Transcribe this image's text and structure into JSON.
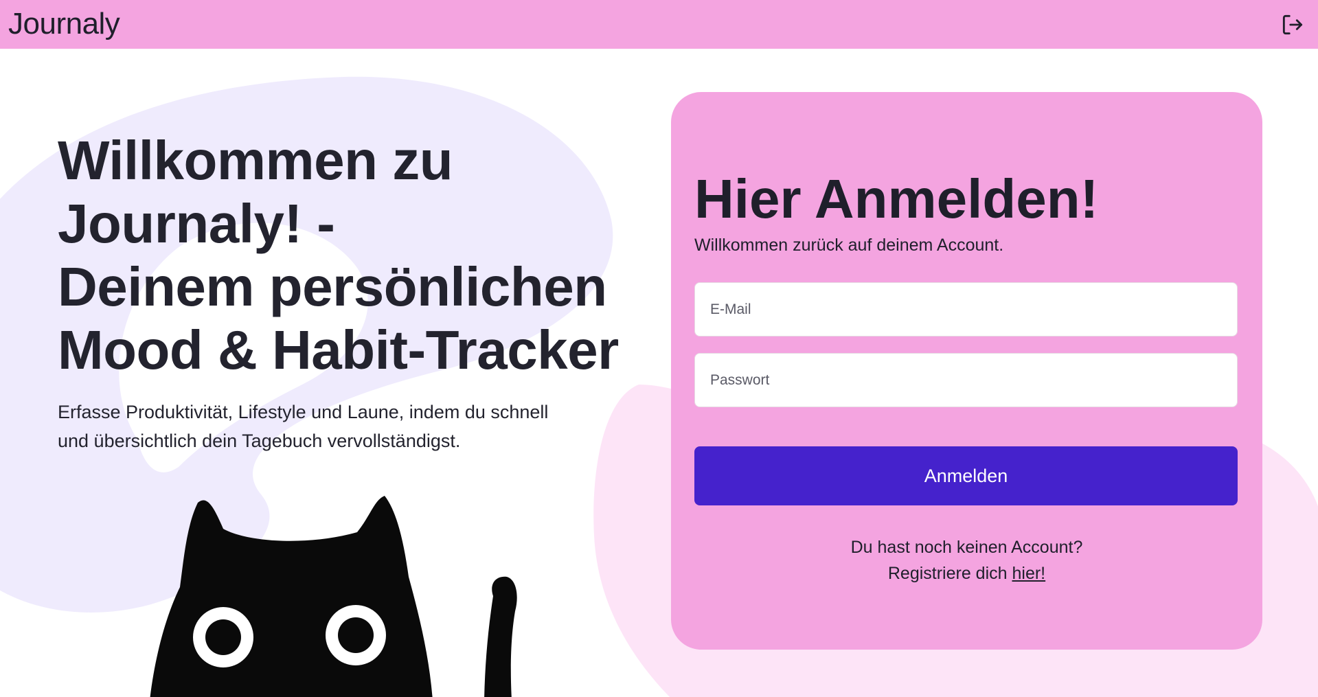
{
  "navbar": {
    "brand": "Journaly",
    "logout_icon": "logout-icon"
  },
  "colors": {
    "navbar_bg": "#f4a4e0",
    "card_bg": "#f4a4e0",
    "button_bg": "#4522cc",
    "blob_left": "#efebfd",
    "blob_right": "#fde4f7"
  },
  "hero": {
    "title_lines": [
      "Willkommen zu",
      "Journaly! -",
      "Deinem persönlichen",
      "Mood & Habit-Tracker"
    ],
    "subtitle": "Erfasse Produktivität, Lifestyle und Laune, indem du schnell und übersichtlich dein Tagebuch vervollständigst.",
    "illustration": "black-cat-illustration"
  },
  "login": {
    "title": "Hier Anmelden!",
    "subtitle": "Willkommen zurück auf deinem Account.",
    "email_placeholder": "E-Mail",
    "password_placeholder": "Passwort",
    "submit_label": "Anmelden",
    "no_account_text": "Du hast noch keinen Account?",
    "register_prefix": "Registriere dich ",
    "register_link": "hier!"
  }
}
